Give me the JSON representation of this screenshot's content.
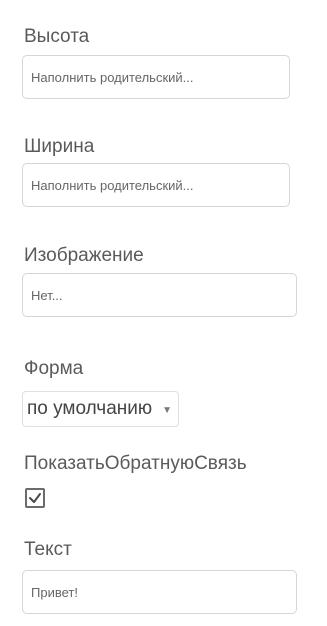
{
  "properties": {
    "height": {
      "label": "Высота",
      "value": "Наполнить родительский..."
    },
    "width": {
      "label": "Ширина",
      "value": "Наполнить родительский..."
    },
    "image": {
      "label": "Изображение",
      "value": "Нет..."
    },
    "shape": {
      "label": "Форма",
      "value": "по умолчанию",
      "caret_icon": "caret-down-icon"
    },
    "show_feedback": {
      "label": "ПоказатьОбратнуюСвязь",
      "checked": true,
      "icon": "checkmark-icon"
    },
    "text": {
      "label": "Текст",
      "value": "Привет!"
    }
  }
}
